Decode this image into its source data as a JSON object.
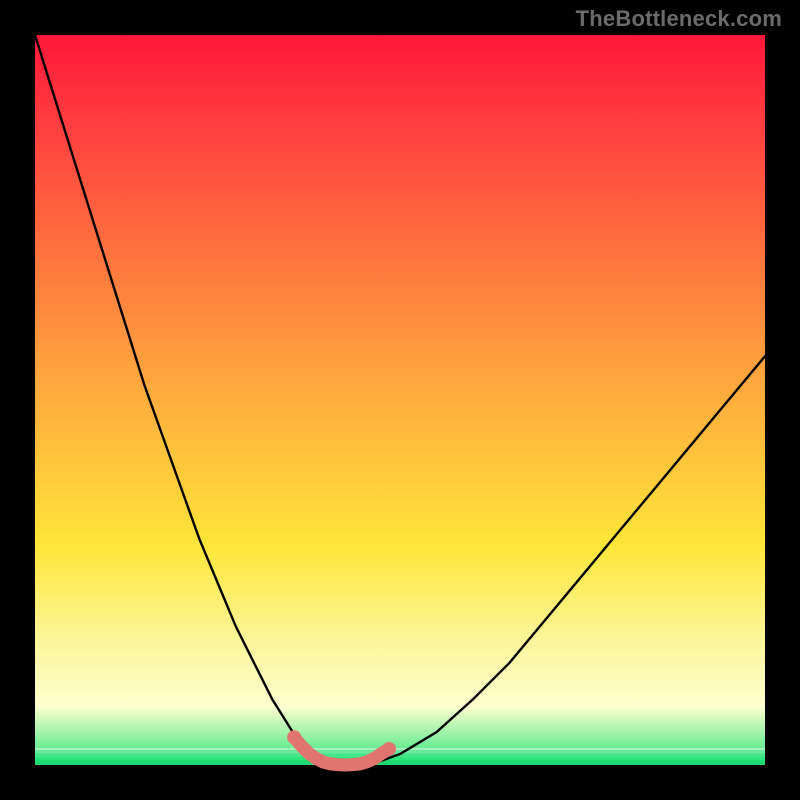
{
  "watermark": {
    "text": "TheBottleneck.com"
  },
  "colors": {
    "black": "#000000",
    "curve": "#000000",
    "highlight": "#e2746f",
    "gradient_top": "#ff173a",
    "gradient_mid_red": "#ff3d3f",
    "gradient_orange": "#ffa03e",
    "gradient_yellow": "#ffe63a",
    "gradient_lightyellow": "#fbf69a",
    "gradient_paleyellow": "#feffcf",
    "gradient_green": "#2de57b"
  },
  "chart_data": {
    "type": "line",
    "title": "",
    "xlabel": "",
    "ylabel": "",
    "xlim": [
      0,
      100
    ],
    "ylim": [
      0,
      100
    ],
    "legend": false,
    "grid": false,
    "series": [
      {
        "name": "bottleneck-curve",
        "x": [
          0,
          2.5,
          5,
          7.5,
          10,
          12.5,
          15,
          17.5,
          20,
          22.5,
          25,
          27.5,
          30,
          32.5,
          35,
          36,
          37,
          38,
          39,
          40,
          41,
          42,
          43,
          44,
          45,
          47.5,
          50,
          55,
          60,
          65,
          70,
          75,
          80,
          85,
          90,
          95,
          100
        ],
        "y": [
          100,
          92,
          84,
          76,
          68,
          60,
          52,
          45,
          38,
          31,
          25,
          19,
          14,
          9,
          5,
          3.5,
          2.3,
          1.4,
          0.7,
          0.3,
          0.1,
          0,
          0,
          0,
          0.1,
          0.6,
          1.5,
          4.5,
          9,
          14,
          20,
          26,
          32,
          38,
          44,
          50,
          56
        ]
      },
      {
        "name": "optimal-zone",
        "x": [
          35.5,
          36.5,
          37.5,
          38.5,
          39.5,
          40.5,
          41.5,
          42.5,
          43.5,
          44.5,
          45.5,
          46.5,
          47.5,
          48.5
        ],
        "y": [
          3.8,
          2.6,
          1.6,
          0.9,
          0.4,
          0.15,
          0.05,
          0,
          0.05,
          0.15,
          0.45,
          0.9,
          1.6,
          2.2
        ]
      }
    ],
    "annotations": []
  }
}
